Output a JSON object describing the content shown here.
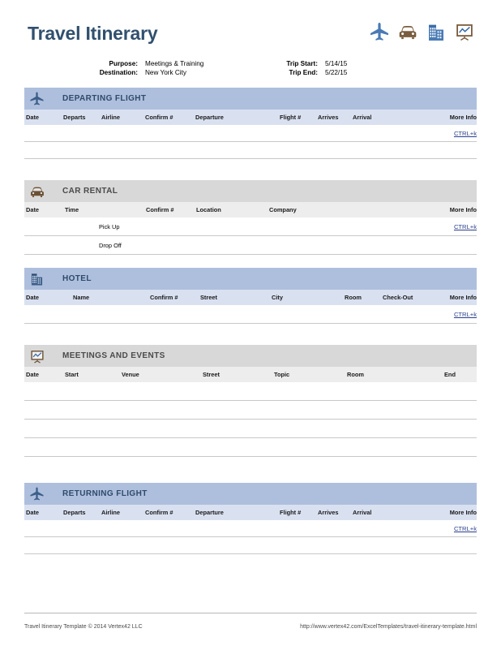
{
  "document": {
    "title": "Travel Itinerary"
  },
  "header_icons": [
    {
      "name": "plane-icon",
      "color": "#4a7ab5"
    },
    {
      "name": "car-icon",
      "color": "#7a5c3e"
    },
    {
      "name": "building-icon",
      "color": "#4a7ab5"
    },
    {
      "name": "presentation-chart-icon",
      "color": "#7a5c3e"
    }
  ],
  "trip_info": {
    "purpose_label": "Purpose:",
    "purpose_value": "Meetings & Training",
    "destination_label": "Destination:",
    "destination_value": "New York City",
    "trip_start_label": "Trip Start:",
    "trip_start_value": "5/14/15",
    "trip_end_label": "Trip End:",
    "trip_end_value": "5/22/15"
  },
  "colors": {
    "title": "#31506e",
    "blue_header": "#aebfdd",
    "blue_columns": "#d9e1f1",
    "gray_header": "#d8d8d8",
    "gray_columns": "#ededed",
    "link": "#2b3f8c"
  },
  "more_info_link": "CTRL+k",
  "sections": {
    "departing_flight": {
      "title": "DEPARTING FLIGHT",
      "icon": "plane-icon",
      "theme": "blue",
      "columns": [
        "Date",
        "Departs",
        "Airline",
        "Confirm #",
        "Departure",
        "Flight #",
        "Arrives",
        "Arrival",
        "More Info"
      ],
      "rows": [
        {
          "date": "",
          "departs": "",
          "airline": "",
          "confirm": "",
          "departure": "",
          "flight": "",
          "arrives": "",
          "arrival": "",
          "more_info": "CTRL+k"
        },
        {
          "date": "",
          "departs": "",
          "airline": "",
          "confirm": "",
          "departure": "",
          "flight": "",
          "arrives": "",
          "arrival": "",
          "more_info": ""
        }
      ]
    },
    "car_rental": {
      "title": "CAR RENTAL",
      "icon": "car-icon",
      "theme": "gray",
      "columns": [
        "Date",
        "Time",
        "Confirm #",
        "Location",
        "Company",
        "More Info"
      ],
      "rows": [
        {
          "date": "",
          "time": "Pick Up",
          "confirm": "",
          "location": "",
          "company": "",
          "more_info": "CTRL+k"
        },
        {
          "date": "",
          "time": "Drop Off",
          "confirm": "",
          "location": "",
          "company": "",
          "more_info": ""
        }
      ]
    },
    "hotel": {
      "title": "HOTEL",
      "icon": "building-icon",
      "theme": "blue",
      "columns": [
        "Date",
        "Name",
        "Confirm #",
        "Street",
        "City",
        "Room",
        "Check-Out",
        "More Info"
      ],
      "rows": [
        {
          "date": "",
          "name": "",
          "confirm": "",
          "street": "",
          "city": "",
          "room": "",
          "checkout": "",
          "more_info": "CTRL+k"
        }
      ]
    },
    "meetings_and_events": {
      "title": "MEETINGS AND EVENTS",
      "icon": "presentation-chart-icon",
      "theme": "gray",
      "columns": [
        "Date",
        "Start",
        "Venue",
        "Street",
        "Topic",
        "Room",
        "End"
      ],
      "rows": [
        {
          "date": "",
          "start": "",
          "venue": "",
          "street": "",
          "topic": "",
          "room": "",
          "end": ""
        },
        {
          "date": "",
          "start": "",
          "venue": "",
          "street": "",
          "topic": "",
          "room": "",
          "end": ""
        },
        {
          "date": "",
          "start": "",
          "venue": "",
          "street": "",
          "topic": "",
          "room": "",
          "end": ""
        },
        {
          "date": "",
          "start": "",
          "venue": "",
          "street": "",
          "topic": "",
          "room": "",
          "end": ""
        }
      ]
    },
    "returning_flight": {
      "title": "RETURNING FLIGHT",
      "icon": "plane-icon",
      "theme": "blue",
      "columns": [
        "Date",
        "Departs",
        "Airline",
        "Confirm #",
        "Departure",
        "Flight #",
        "Arrives",
        "Arrival",
        "More Info"
      ],
      "rows": [
        {
          "date": "",
          "departs": "",
          "airline": "",
          "confirm": "",
          "departure": "",
          "flight": "",
          "arrives": "",
          "arrival": "",
          "more_info": "CTRL+k"
        },
        {
          "date": "",
          "departs": "",
          "airline": "",
          "confirm": "",
          "departure": "",
          "flight": "",
          "arrives": "",
          "arrival": "",
          "more_info": ""
        }
      ]
    }
  },
  "footer": {
    "copyright": "Travel Itinerary Template © 2014 Vertex42 LLC",
    "url": "http://www.vertex42.com/ExcelTemplates/travel-itinerary-template.html"
  }
}
